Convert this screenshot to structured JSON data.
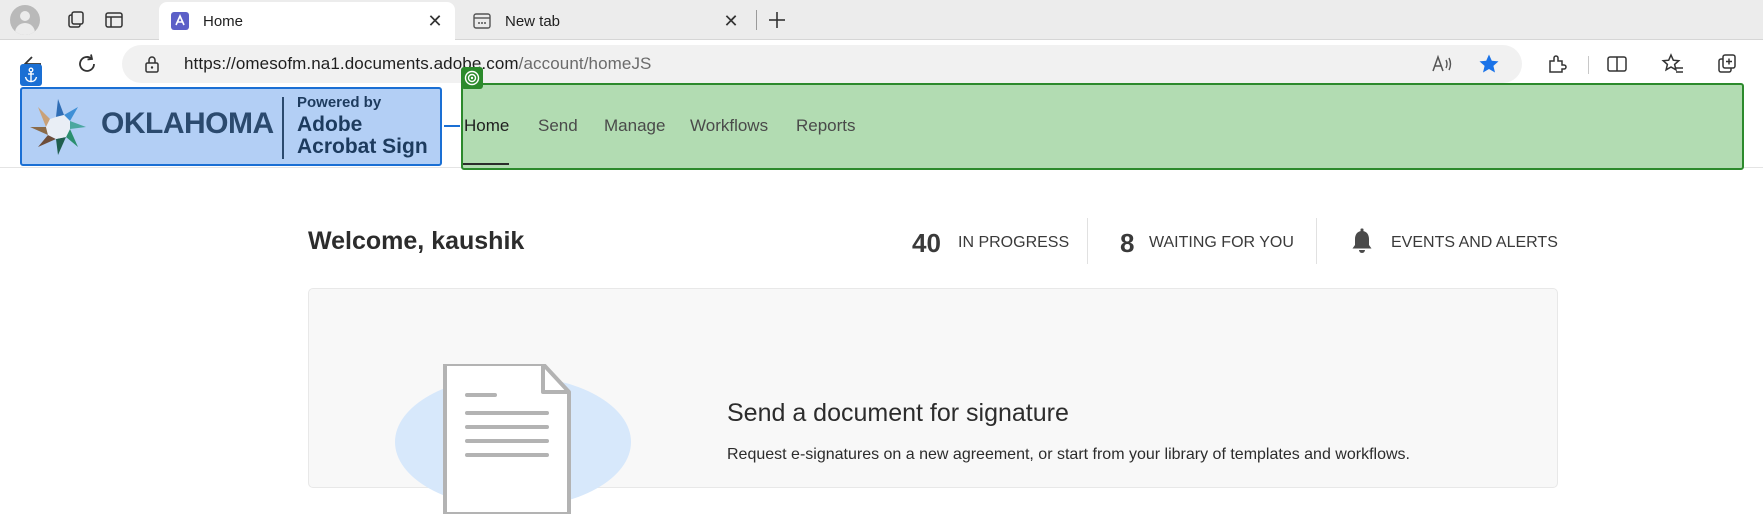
{
  "browser": {
    "tabs": [
      {
        "title": "Home",
        "close": "✕"
      },
      {
        "title": "New tab",
        "close": "✕"
      }
    ],
    "new_tab_symbol": "+",
    "url_host": "https://omesofm.na1.documents.adobe.com",
    "url_path": "/account/homeJS",
    "icons": [
      "profile-avatar",
      "collections-icon",
      "sidebar-icon",
      "back-icon",
      "refresh-icon",
      "lock-icon",
      "read-aloud-icon",
      "favorite-star-icon",
      "extensions-icon",
      "split-screen-icon",
      "favorites-icon",
      "collections-add-icon"
    ],
    "accent": "#1a73e8"
  },
  "header": {
    "logo": {
      "state_name": "OKLAHOMA",
      "powered_by": "Powered by",
      "brand_line1": "Adobe",
      "brand_line2": "Acrobat Sign"
    },
    "nav": [
      {
        "label": "Home",
        "active": true
      },
      {
        "label": "Send",
        "active": false
      },
      {
        "label": "Manage",
        "active": false
      },
      {
        "label": "Workflows",
        "active": false
      },
      {
        "label": "Reports",
        "active": false
      }
    ],
    "overlay_colors": {
      "logo_box": "#b3cff5",
      "nav_box": "#b2dcb2"
    }
  },
  "welcome": {
    "greeting": "Welcome, kaushik",
    "stats": [
      {
        "count": "40",
        "label": "IN PROGRESS"
      },
      {
        "count": "8",
        "label": "WAITING FOR YOU"
      }
    ],
    "alerts_label": "EVENTS AND ALERTS"
  },
  "card": {
    "title": "Send a document for signature",
    "description": "Request e-signatures on a new agreement, or start from your library of templates and workflows."
  }
}
